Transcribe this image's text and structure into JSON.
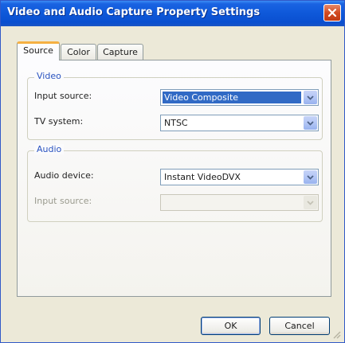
{
  "window": {
    "title": "Video and Audio Capture Property Settings",
    "close_icon": "close-icon"
  },
  "tabs": [
    {
      "label": "Source",
      "active": true
    },
    {
      "label": "Color",
      "active": false
    },
    {
      "label": "Capture",
      "active": false
    }
  ],
  "video": {
    "group_title": "Video",
    "input_source_label": "Input source:",
    "input_source_value": "Video Composite",
    "tv_system_label": "TV system:",
    "tv_system_value": "NTSC"
  },
  "audio": {
    "group_title": "Audio",
    "audio_device_label": "Audio device:",
    "audio_device_value": "Instant VideoDVX",
    "input_source_label": "Input source:",
    "input_source_value": ""
  },
  "buttons": {
    "ok": "OK",
    "cancel": "Cancel"
  },
  "colors": {
    "titlebar": "#0e58d9",
    "selection": "#316ac5",
    "group_title": "#2a53c0",
    "close_button": "#d24b22"
  }
}
